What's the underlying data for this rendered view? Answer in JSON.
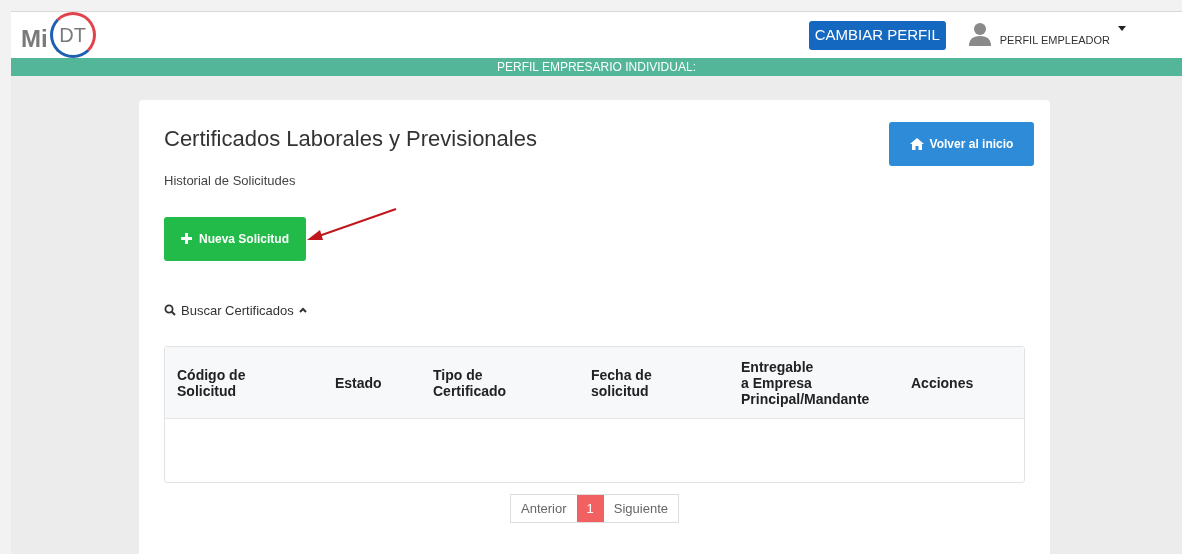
{
  "header": {
    "logo": {
      "prefix": "Mi",
      "badge": "DT"
    },
    "switch_button": "CAMBIAR PERFIL",
    "user_menu": "PERFIL EMPLEADOR"
  },
  "banner": "PERFIL EMPRESARIO INDIVIDUAL:",
  "card": {
    "title": "Certificados Laborales y Previsionales",
    "subtitle": "Historial de Solicitudes",
    "home_button": "Volver al inicio",
    "new_button": "Nueva Solicitud",
    "search_toggle": {
      "label": "Buscar Certificados",
      "expanded": true
    },
    "table": {
      "columns": [
        "Código de\nSolicitud",
        "Estado",
        "Tipo de\nCertificado",
        "Fecha de\nsolicitud",
        "Entregable\na Empresa\nPrincipal/Mandante",
        "Acciones"
      ]
    },
    "pagination": [
      {
        "label": "Anterior",
        "selected": false
      },
      {
        "label": "1",
        "selected": true
      },
      {
        "label": "Siguiente",
        "selected": false
      }
    ]
  }
}
